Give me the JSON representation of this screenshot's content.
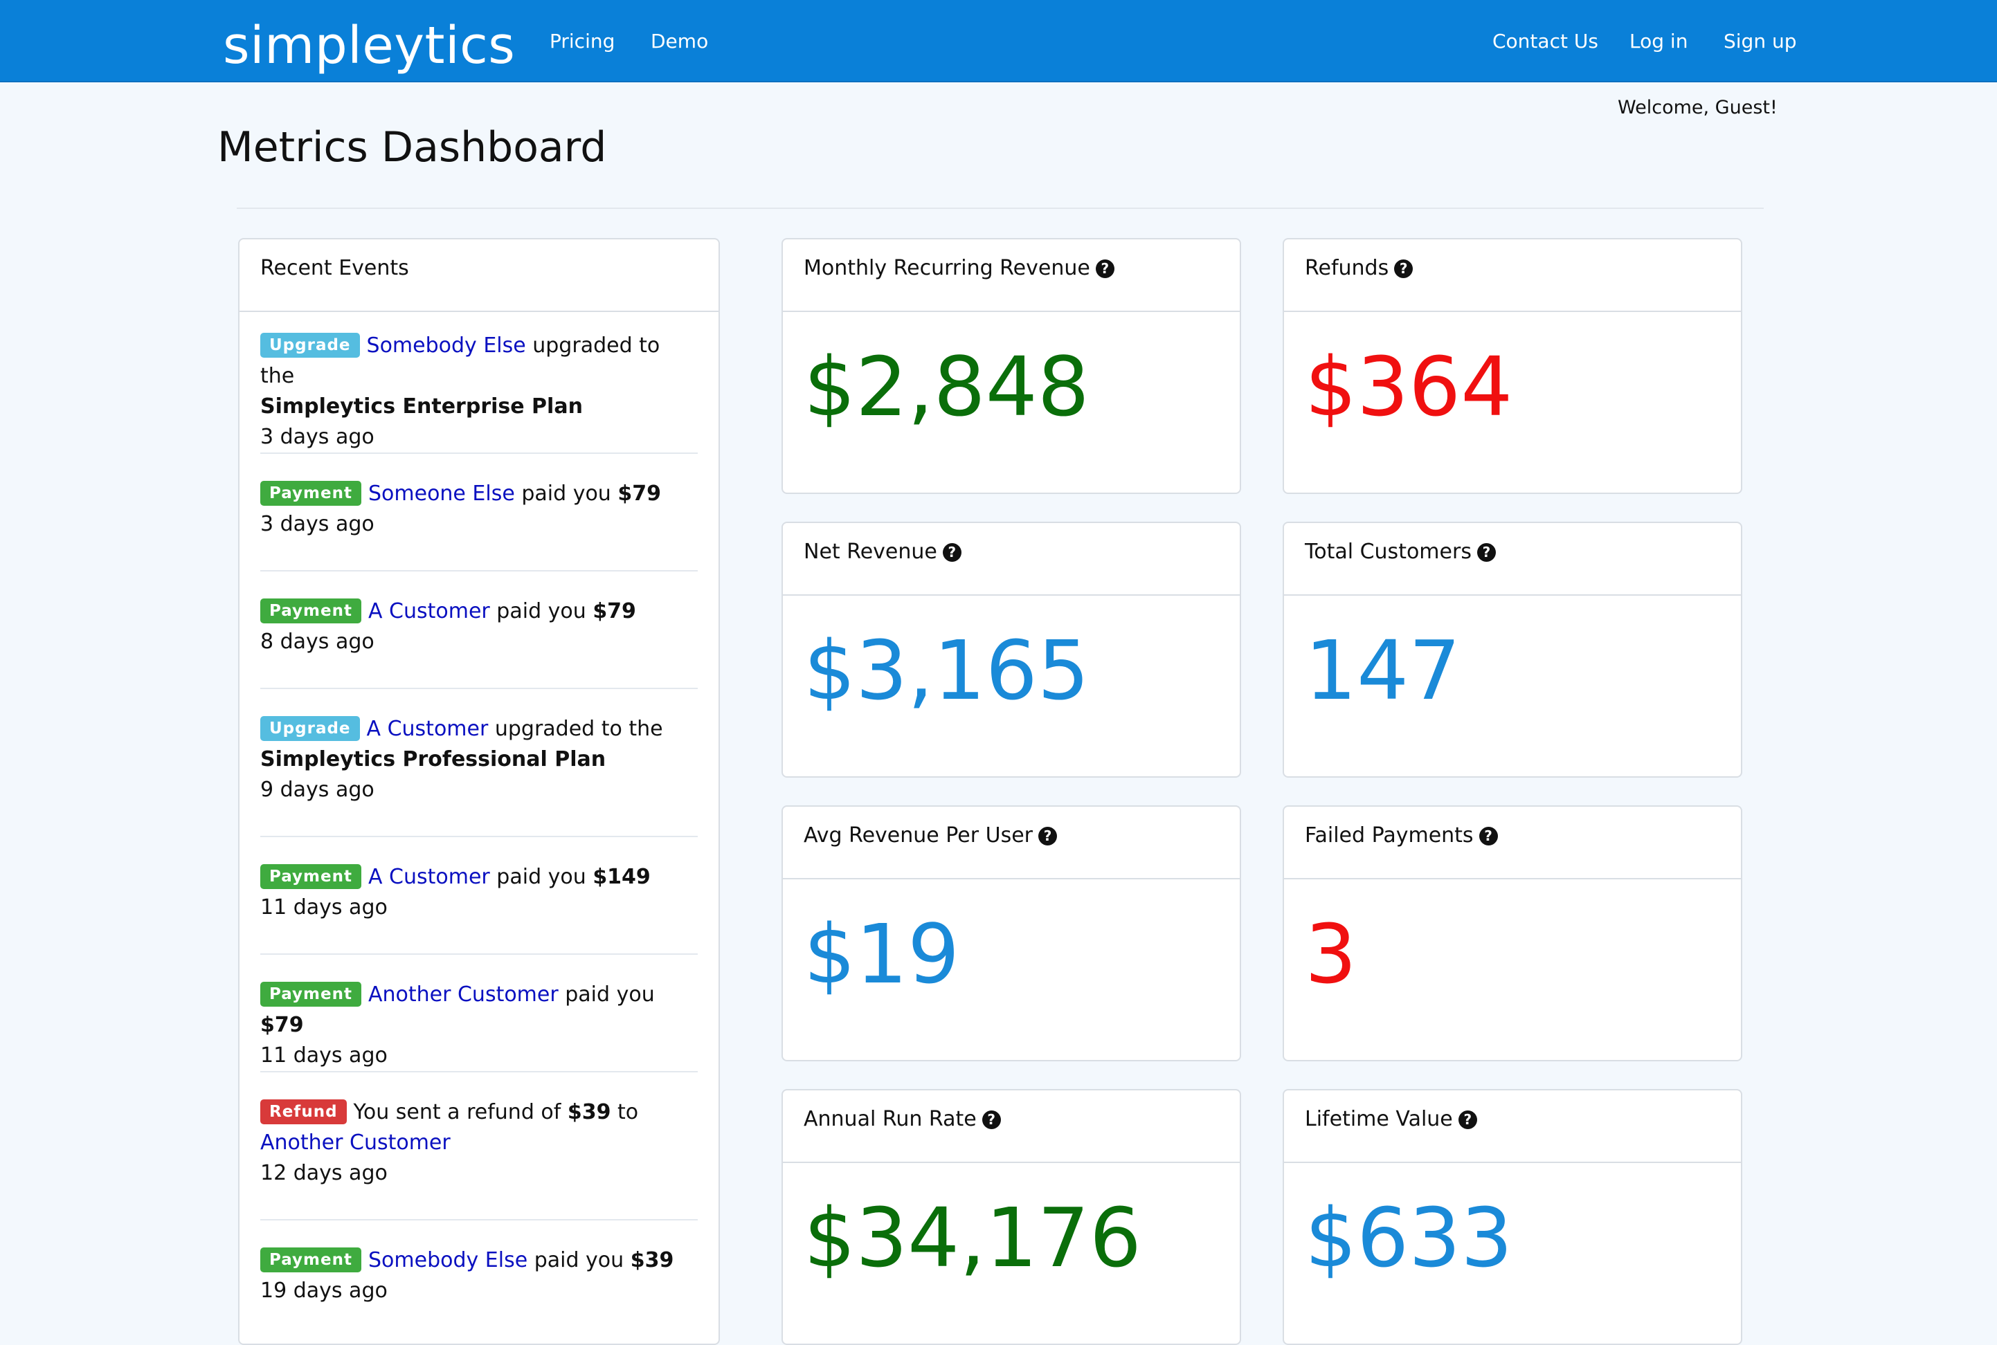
{
  "nav": {
    "brand": "simpleytics",
    "links": [
      "Pricing",
      "Demo"
    ],
    "right_links": [
      "Contact Us",
      "Log in",
      "Sign up"
    ]
  },
  "welcome": "Welcome, Guest!",
  "page_title": "Metrics Dashboard",
  "events": {
    "title": "Recent Events",
    "items": [
      {
        "badge": "Upgrade",
        "customer": "Somebody Else",
        "text": " upgraded to the",
        "plan": "Simpleytics Enterprise Plan",
        "time": "3 days ago"
      },
      {
        "badge": "Payment",
        "customer": "Someone Else",
        "text": " paid you ",
        "amount": "$79",
        "time": "3 days ago"
      },
      {
        "badge": "Payment",
        "customer": "A Customer",
        "text": " paid you ",
        "amount": "$79",
        "time": "8 days ago"
      },
      {
        "badge": "Upgrade",
        "customer": "A Customer",
        "text": " upgraded to the",
        "plan": "Simpleytics Professional Plan",
        "time": "9 days ago"
      },
      {
        "badge": "Payment",
        "customer": "A Customer",
        "text": " paid you ",
        "amount": "$149",
        "time": "11 days ago"
      },
      {
        "badge": "Payment",
        "customer": "Another Customer",
        "text": " paid you ",
        "amount": "$79",
        "time": "11 days ago"
      },
      {
        "badge": "Refund",
        "text_before": "You sent a refund of ",
        "amount": "$39",
        "text_after": " to",
        "customer": "Another Customer",
        "time": "12 days ago"
      },
      {
        "badge": "Payment",
        "customer": "Somebody Else",
        "text": " paid you ",
        "amount": "$39",
        "time": "19 days ago"
      }
    ]
  },
  "metrics": {
    "mrr": {
      "title": "Monthly Recurring Revenue",
      "value": "$2,848"
    },
    "refunds": {
      "title": "Refunds",
      "value": "$364"
    },
    "net_revenue": {
      "title": "Net Revenue",
      "value": "$3,165"
    },
    "total_customers": {
      "title": "Total Customers",
      "value": "147"
    },
    "arpu": {
      "title": "Avg Revenue Per User",
      "value": "$19"
    },
    "failed_payments": {
      "title": "Failed Payments",
      "value": "3"
    },
    "arr": {
      "title": "Annual Run Rate",
      "value": "$34,176"
    },
    "ltv": {
      "title": "Lifetime Value",
      "value": "$633"
    }
  },
  "help_glyph": "?",
  "colors": {
    "navbar": "#0a80d8",
    "positive": "#0a6e0a",
    "negative": "#f01010",
    "neutral": "#1a8ad8",
    "customer_link": "#0a10c0"
  }
}
